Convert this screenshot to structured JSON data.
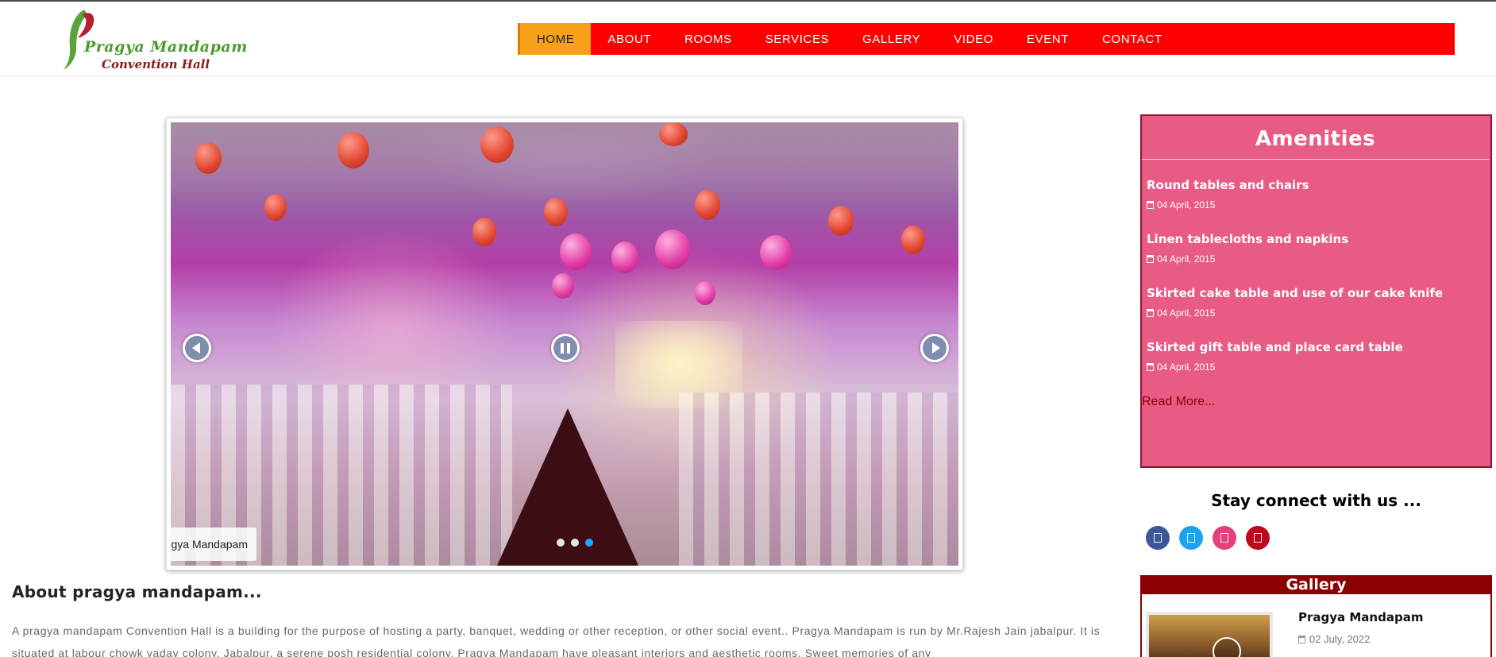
{
  "brand": {
    "name": "Pragya Mandapam",
    "subtitle": "Convention Hall",
    "colors": {
      "nav_bg": "#ff0000",
      "nav_active": "#f7a11a",
      "amenities_bg": "#e85b85",
      "gallery_border": "#8b0000"
    }
  },
  "nav": {
    "items": [
      {
        "label": "HOME",
        "active": true
      },
      {
        "label": "ABOUT"
      },
      {
        "label": "ROOMS"
      },
      {
        "label": "SERVICES"
      },
      {
        "label": "GALLERY"
      },
      {
        "label": "VIDEO"
      },
      {
        "label": "EVENT"
      },
      {
        "label": "CONTACT"
      }
    ]
  },
  "slider": {
    "caption": "gya Mandapam",
    "prev_icon": "arrow-left-icon",
    "pause_icon": "pause-icon",
    "next_icon": "arrow-right-icon",
    "dots_total": 3,
    "active_dot": 3
  },
  "about": {
    "title": "About pragya mandapam...",
    "text": "A pragya mandapam Convention Hall is a building for the purpose of hosting a party, banquet, wedding or other reception, or other social event.. Pragya Mandapam is run by Mr.Rajesh Jain jabalpur. It is situated at labour chowk yadav colony, Jabalpur, a serene posh residential colony. Pragya Mandapam have pleasant interiors and aesthetic rooms. Sweet memories of any"
  },
  "amenities": {
    "title": "Amenities",
    "items": [
      {
        "name": "Round tables and chairs",
        "date": "04 April, 2015"
      },
      {
        "name": "Linen tablecloths and napkins",
        "date": "04 April, 2015"
      },
      {
        "name": "Skirted cake table and use of our cake knife",
        "date": "04 April, 2015"
      },
      {
        "name": "Skirted gift table and place card table",
        "date": "04 April, 2015"
      }
    ],
    "read_more": "Read More..."
  },
  "social": {
    "heading": "Stay connect with us ...",
    "links": [
      {
        "icon": "facebook-icon",
        "color": "#3b5998"
      },
      {
        "icon": "twitter-icon",
        "color": "#1da1f2"
      },
      {
        "icon": "instagram-icon",
        "color": "#e4407b"
      },
      {
        "icon": "pinterest-icon",
        "color": "#bd081c"
      }
    ]
  },
  "gallery": {
    "title": "Gallery",
    "items": [
      {
        "name": "Pragya Mandapam",
        "date": "02 July, 2022"
      }
    ]
  }
}
